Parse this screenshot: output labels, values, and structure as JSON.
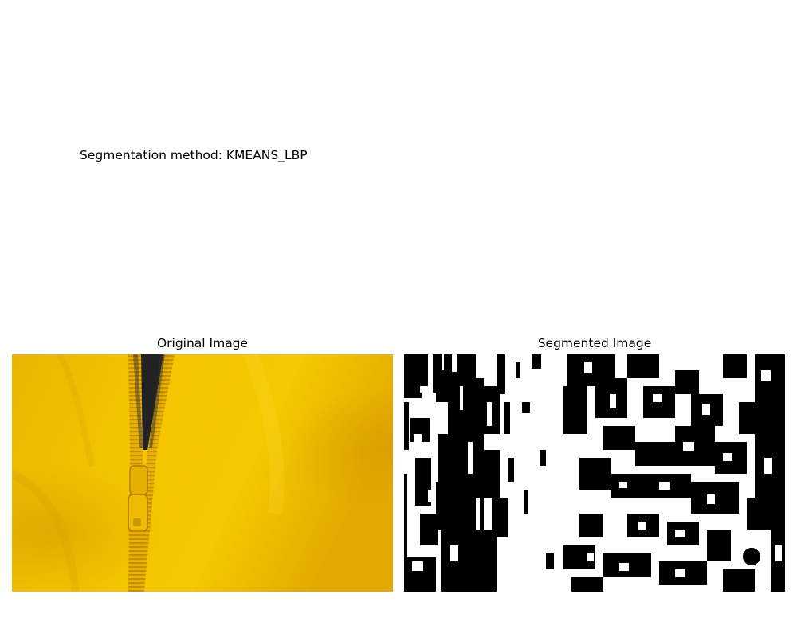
{
  "figure": {
    "method_text": "Segmentation method: KMEANS_LBP"
  },
  "panels": [
    {
      "title": "Original Image",
      "content": "photo-yellow-jacket-zipper"
    },
    {
      "title": "Segmented Image",
      "content": "binary-mask-black-white"
    }
  ],
  "colors": {
    "background": "#ffffff",
    "text": "#000000",
    "jacket_yellow": "#f2c200",
    "mask_foreground": "#ffffff",
    "mask_background": "#000000"
  }
}
